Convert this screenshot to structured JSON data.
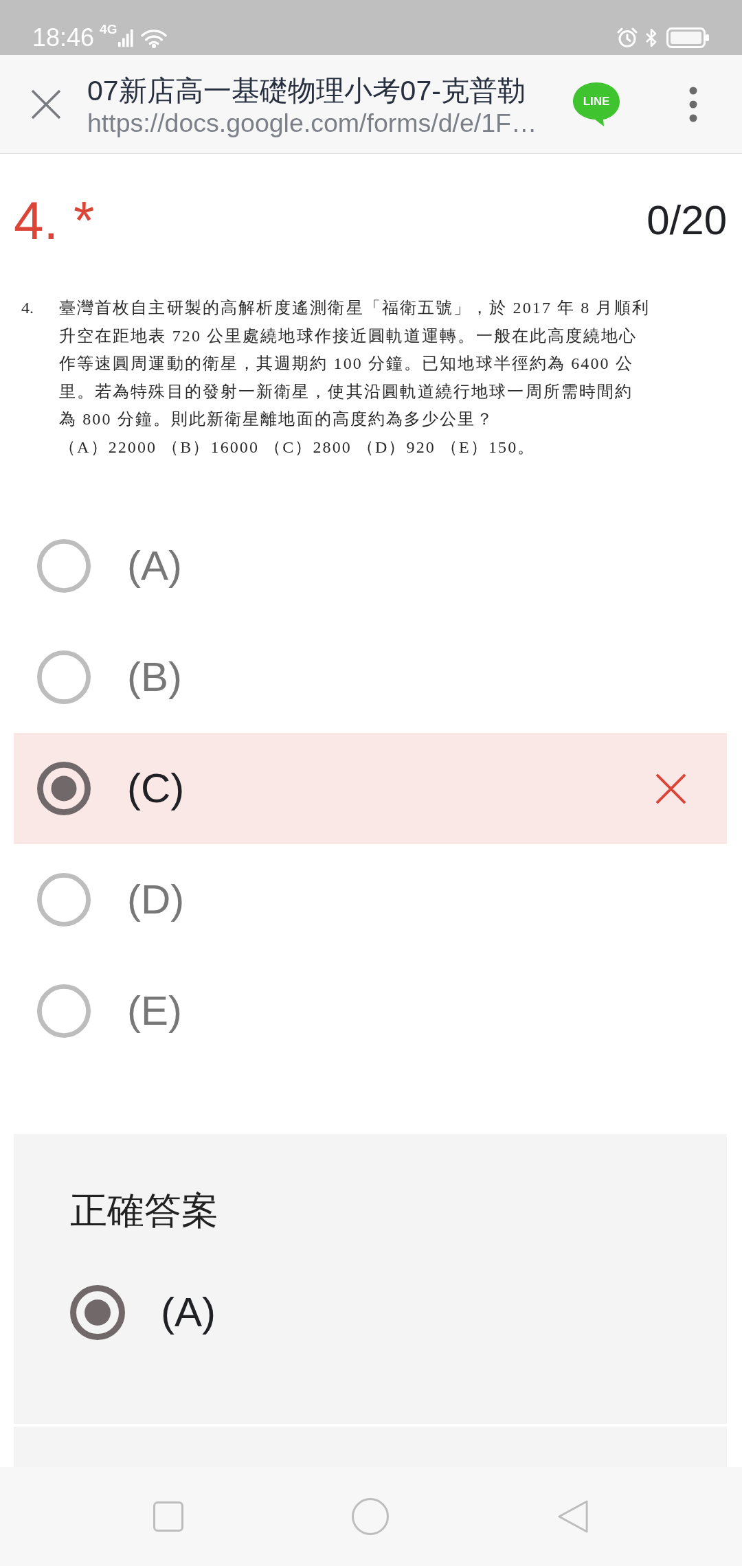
{
  "status_bar": {
    "time": "18:46",
    "network": "4G"
  },
  "header": {
    "title": "07新店高一基礎物理小考07-克普勒",
    "url": "https://docs.google.com/forms/d/e/1F…",
    "share_label": "LINE"
  },
  "question": {
    "number": "4.",
    "required_mark": "*",
    "score": "0/20"
  },
  "question_image": {
    "number": "4.",
    "lines": [
      "臺灣首枚自主研製的高解析度遙測衛星「福衛五號」，於 2017 年 8 月順利",
      "升空在距地表 720 公里處繞地球作接近圓軌道運轉。一般在此高度繞地心",
      "作等速圓周運動的衛星，其週期約 100 分鐘。已知地球半徑約為 6400 公",
      "里。若為特殊目的發射一新衛星，使其沿圓軌道繞行地球一周所需時間約",
      "為 800 分鐘。則此新衛星離地面的高度約為多少公里？"
    ],
    "choices": "（A）22000 （B）16000 （C）2800 （D）920 （E）150。"
  },
  "options": [
    {
      "label": "(A)",
      "selected": false,
      "wrong": false
    },
    {
      "label": "(B)",
      "selected": false,
      "wrong": false
    },
    {
      "label": "(C)",
      "selected": true,
      "wrong": true
    },
    {
      "label": "(D)",
      "selected": false,
      "wrong": false
    },
    {
      "label": "(E)",
      "selected": false,
      "wrong": false
    }
  ],
  "correct_answer": {
    "title": "正確答案",
    "answers": [
      {
        "label": "(A)",
        "selected": true
      }
    ]
  }
}
